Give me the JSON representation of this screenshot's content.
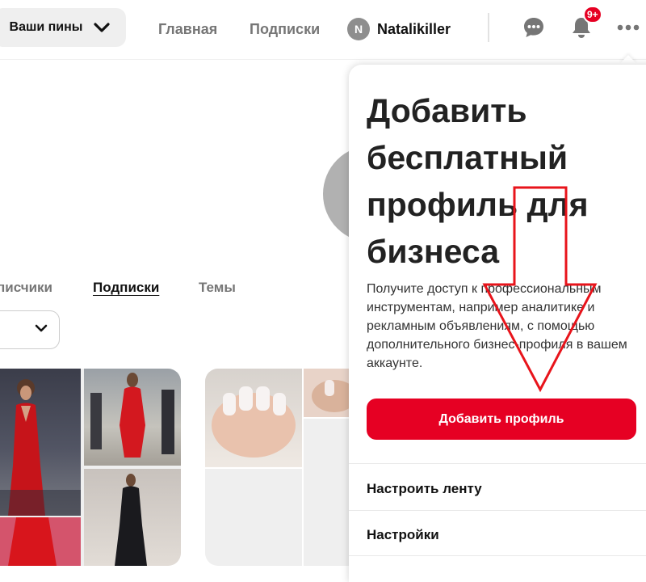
{
  "header": {
    "pins_dropdown_label": "Ваши пины",
    "nav_home": "Главная",
    "nav_following": "Подписки",
    "user_initial": "N",
    "username": "Natalikiller",
    "notifications_badge": "9+"
  },
  "profile": {
    "tabs": [
      "писчики",
      "Подписки",
      "Темы"
    ]
  },
  "dropdown": {
    "promo_title": "Добавить бесплатный профиль для бизнеса",
    "promo_description": "Получите доступ к профессиональным инструментам, например аналитике и рекламным объявлениям, с помощью дополнительного бизнес-профиля в вашем аккаунте.",
    "add_profile_button": "Добавить профиль",
    "menu": [
      "Настроить ленту",
      "Настройки"
    ]
  },
  "colors": {
    "brand_red": "#e60023",
    "annotation_arrow": "#e8141b"
  },
  "icons": [
    "chevron-down-icon",
    "speech-bubble-icon",
    "bell-icon",
    "ellipsis-icon"
  ]
}
